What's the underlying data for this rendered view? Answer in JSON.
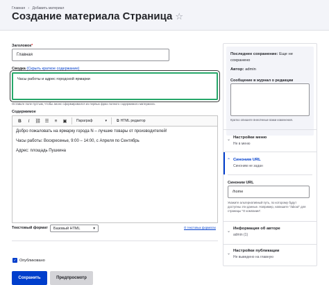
{
  "breadcrumb": [
    "Главная",
    "Добавить материал"
  ],
  "page_title": "Создание материала Страница",
  "title_field": {
    "label": "Заголовок",
    "required_mark": "*",
    "value": "Главная"
  },
  "summary_field": {
    "label": "Сводка",
    "toggle_link": "(Скрыть краткое содержание)",
    "value": "Часы работы и адрес городской ярмарки",
    "help": "Оставьте поле пустым, чтобы анонс сформировался из первых фраз полного содержимого материала."
  },
  "body_field": {
    "label": "Содержимое",
    "toolbar": {
      "bold": "B",
      "italic": "I",
      "heading_select": "Параграф",
      "source_button": "HTML редактор"
    },
    "paragraphs": [
      "Добро пожаловать на ярмарку города N – лучшие товары от производителей!",
      "Часы работы: Воскресенье, 9:00 – 14:00, с Апреля по Сентябрь",
      "Адрес: площадь Пушкина"
    ]
  },
  "text_format": {
    "label": "Текстовый формат",
    "value": "Базовый HTML",
    "help_link": "О текстовых форматах"
  },
  "published": {
    "label": "Опубликовано",
    "checked": true
  },
  "buttons": {
    "save": "Сохранить",
    "preview": "Предпросмотр"
  },
  "sidebar": {
    "last_saved_label": "Последнее сохранение:",
    "last_saved_value": "Еще не сохранено",
    "author_label": "Автор:",
    "author_value": "admin",
    "revision_label": "Сообщение в журнал о редакции",
    "revision_help": "Кратко опишите внесённые вами изменения.",
    "menu": {
      "title": "Настройки меню",
      "subtitle": "Не в меню"
    },
    "url_alias": {
      "title": "Синоним URL",
      "subtitle": "Синоним не задан",
      "field_label": "Синоним URL",
      "field_value": "/home",
      "help": "Укажите альтернативный путь, по которому будут доступны эти данные. Например, напишите \"/about\" для страницы \"О компании\"."
    },
    "author_info": {
      "title": "Информация об авторе",
      "subtitle": "admin (1)"
    },
    "publishing": {
      "title": "Настройки публикации",
      "subtitle": "Не выведено на главную"
    }
  }
}
